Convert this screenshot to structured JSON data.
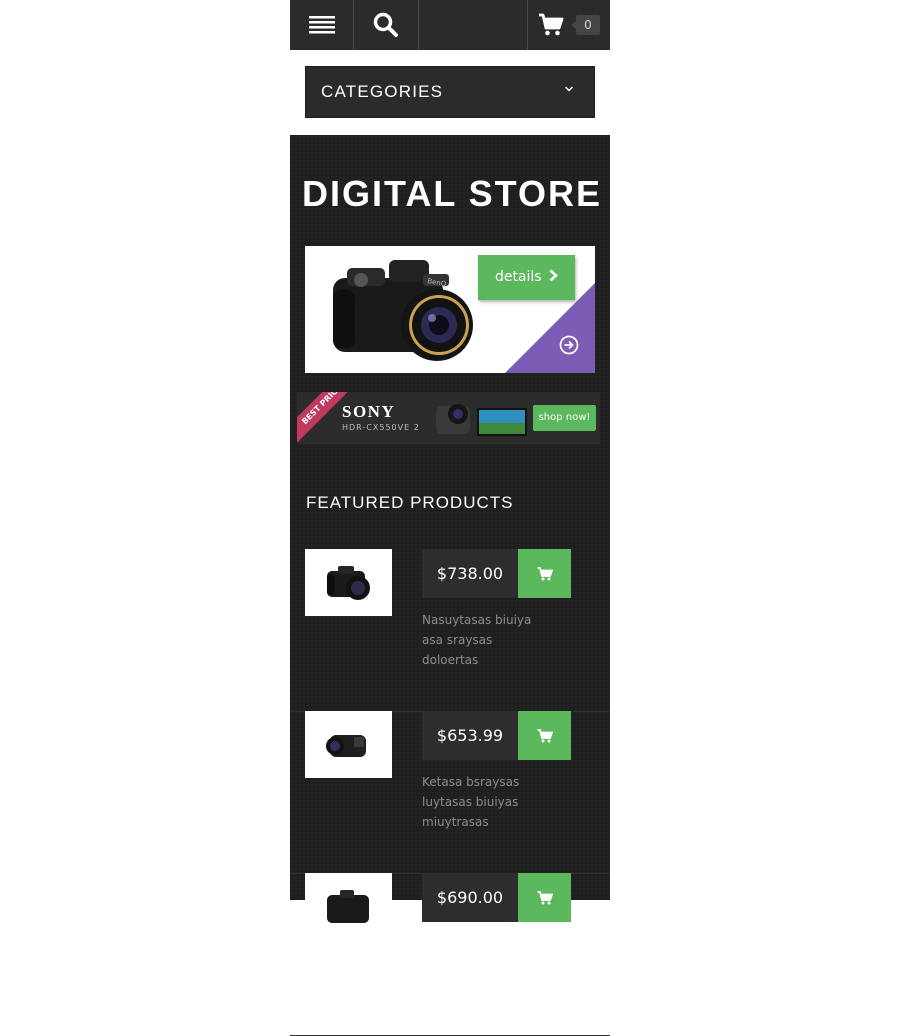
{
  "topbar": {
    "menu_icon": "menu-icon",
    "search_icon": "search-icon",
    "cart_icon": "cart-icon",
    "cart_count": "0"
  },
  "categories": {
    "label": "CATEGORIES"
  },
  "store": {
    "title": "DIGITAL STORE"
  },
  "banner1": {
    "button_label": "details"
  },
  "banner2": {
    "ribbon": "BEST PRICE",
    "brand": "SONY",
    "model": "HDR-CX550VE 2",
    "button_label": "shop now!"
  },
  "featured": {
    "title": "FEATURED PRODUCTS",
    "products": [
      {
        "price": "$738.00",
        "desc": "Nasuytasas biuiya asa sraysas doloertas"
      },
      {
        "price": "$653.99",
        "desc": "Ketasa bsraysas luytasas biuiyas miuytrasas"
      },
      {
        "price": "$690.00",
        "desc": ""
      }
    ]
  },
  "colors": {
    "accent_green": "#5cb85c",
    "accent_purple": "#7c5cb5",
    "dark": "#2b2b2b"
  }
}
